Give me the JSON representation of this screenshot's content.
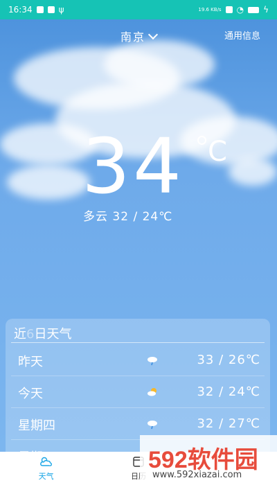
{
  "status_bar": {
    "time": "16:34",
    "net_speed": "19.6 KB/s"
  },
  "header": {
    "city": "南京",
    "info_link": "通用信息"
  },
  "current": {
    "temp": "34",
    "unit": "C",
    "summary": "多云  32  /  24℃"
  },
  "forecast": {
    "title_prefix": "近",
    "title_days": "6",
    "title_suffix": "日天气",
    "rows": [
      {
        "day": "昨天",
        "icon": "rain-cloud-icon",
        "temps": "33  /  26℃"
      },
      {
        "day": "今天",
        "icon": "partly-cloudy-icon",
        "temps": "32  /  24℃"
      },
      {
        "day": "星期四",
        "icon": "rain-cloud-icon",
        "temps": "32  /  27℃"
      },
      {
        "day": "星期五",
        "icon": "rain-cloud-icon",
        "temps": ""
      }
    ]
  },
  "bottom_nav": {
    "items": [
      {
        "label": "天气",
        "icon": "cloud-sun-icon",
        "active": true
      },
      {
        "label": "日历",
        "icon": "calendar-icon",
        "active": false
      }
    ]
  },
  "watermark": {
    "logo_text": "592软件园",
    "url": "www.592xiazai.com"
  },
  "colors": {
    "status_bar": "#16c3b5",
    "sky": "#6aa9ea",
    "accent": "#1aa6e6"
  }
}
